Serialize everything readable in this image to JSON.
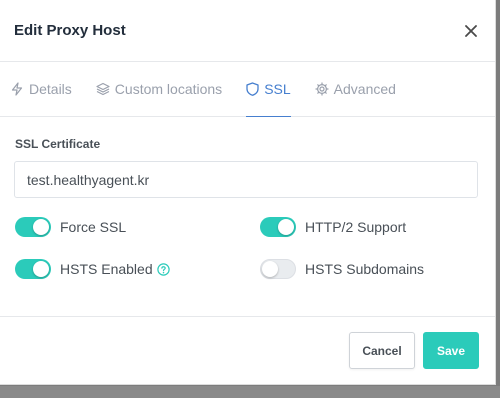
{
  "modal": {
    "title": "Edit Proxy Host",
    "close_icon": "close-icon"
  },
  "tabs": [
    {
      "label": "Details",
      "icon": "lightning-icon",
      "active": false
    },
    {
      "label": "Custom locations",
      "icon": "layers-icon",
      "active": false
    },
    {
      "label": "SSL",
      "icon": "shield-icon",
      "active": true
    },
    {
      "label": "Advanced",
      "icon": "gear-icon",
      "active": false
    }
  ],
  "ssl": {
    "certificate_label": "SSL Certificate",
    "certificate_value": "test.healthyagent.kr",
    "toggles": {
      "force_ssl": {
        "label": "Force SSL",
        "on": true
      },
      "http2": {
        "label": "HTTP/2 Support",
        "on": true
      },
      "hsts_enabled": {
        "label": "HSTS Enabled",
        "on": true
      },
      "hsts_subdomains": {
        "label": "HSTS Subdomains",
        "on": false
      }
    }
  },
  "footer": {
    "cancel_label": "Cancel",
    "save_label": "Save"
  },
  "colors": {
    "accent": "#2bcbba",
    "tab_active": "#467fcf",
    "text": "#495057",
    "muted": "#9aa0ac"
  }
}
